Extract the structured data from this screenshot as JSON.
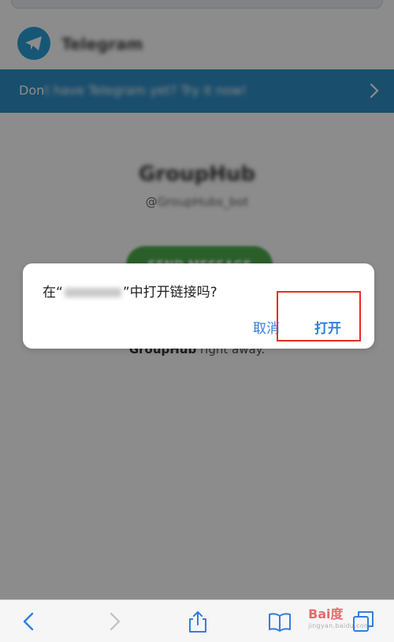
{
  "header": {
    "app_name": "Telegram"
  },
  "banner": {
    "text_prefix": "Don",
    "text_blurred": "t have Telegram yet? Try it now!"
  },
  "group": {
    "name": "GroupHub",
    "handle_prefix": "@",
    "handle_blurred": "GroupHubs_bot",
    "send_label": "SEND MESSAGE",
    "hint_bold": "GroupHub",
    "hint_rest": " right away."
  },
  "dialog": {
    "message_prefix": "在“",
    "message_suffix": "”中打开链接吗?",
    "cancel_label": "取消",
    "open_label": "打开"
  },
  "watermark": {
    "brand": "Bai度",
    "sub": "jingyan.baidu.com"
  },
  "colors": {
    "accent": "#2f7fe0",
    "banner": "#2f8ec6",
    "highlight": "#e42d2d"
  }
}
